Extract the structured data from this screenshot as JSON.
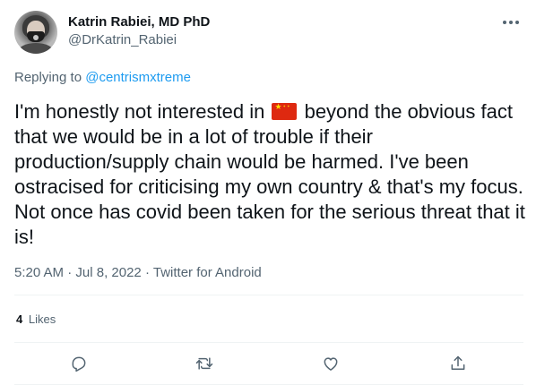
{
  "author": {
    "display_name": "Katrin Rabiei, MD PhD",
    "handle": "@DrKatrin_Rabiei"
  },
  "more_icon": "more-horizontal-icon",
  "reply_context": {
    "prefix": "Replying to",
    "mention": "@centrismxtreme"
  },
  "tweet": {
    "text_before_flag": "I'm honestly not interested in ",
    "flag_icon": "china-flag-emoji",
    "text_after_flag": " beyond the obvious fact that we would be in a lot of trouble if their production/supply chain would be harmed. I've been ostracised for criticising my own country & that's my focus. Not once has covid been taken for the serious threat that it is!"
  },
  "meta": {
    "time": "5:20 AM",
    "separator": "·",
    "date": "Jul 8, 2022",
    "source": "Twitter for Android"
  },
  "stats": {
    "likes_count": "4",
    "likes_label": "Likes"
  },
  "actions": {
    "reply_icon": "reply-icon",
    "retweet_icon": "retweet-icon",
    "like_icon": "heart-icon",
    "share_icon": "share-icon"
  },
  "colors": {
    "text": "#0f1419",
    "secondary": "#536471",
    "link": "#1d9bf0",
    "divider": "#eff3f4"
  }
}
